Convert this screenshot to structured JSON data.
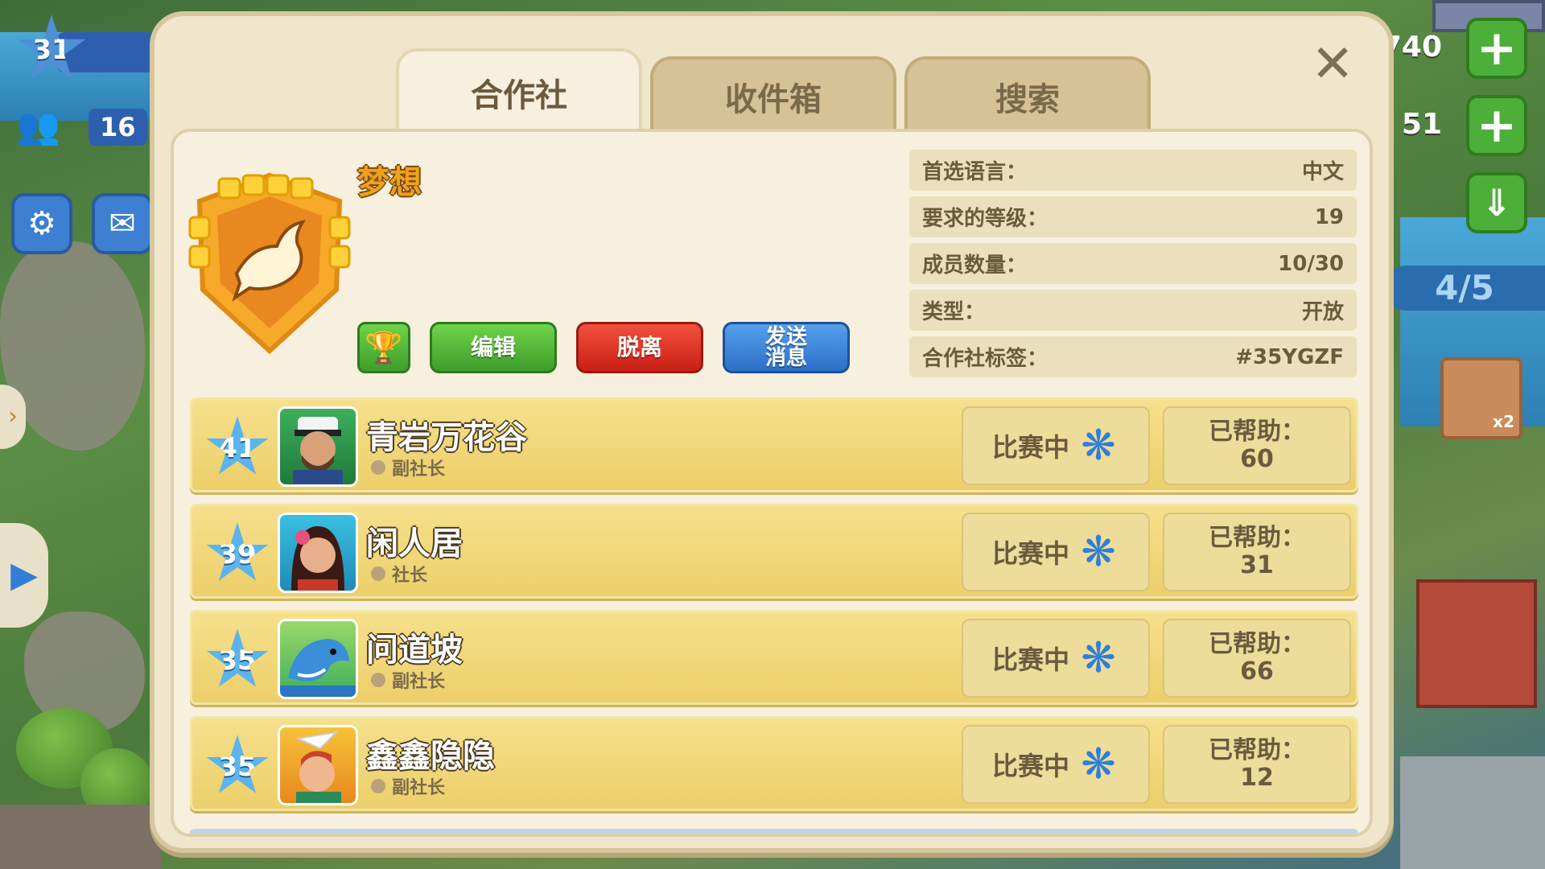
{
  "hud": {
    "level": "31",
    "population": "16",
    "right_value_1": "740",
    "right_value_2": "51",
    "counter": "4/5",
    "heli_multiplier": "x2"
  },
  "tabs": [
    {
      "label": "合作社",
      "active": true
    },
    {
      "label": "收件箱",
      "active": false
    },
    {
      "label": "搜索",
      "active": false
    }
  ],
  "club": {
    "name": "梦想",
    "buttons": {
      "edit": "编辑",
      "leave": "脱离",
      "message": "发送\n消息"
    },
    "info": [
      {
        "label": "首选语言：",
        "value": "中文"
      },
      {
        "label": "要求的等级：",
        "value": "19"
      },
      {
        "label": "成员数量：",
        "value": "10/30"
      },
      {
        "label": "类型：",
        "value": "开放"
      },
      {
        "label": "合作社标签：",
        "value": "#35YGZF"
      }
    ]
  },
  "members": [
    {
      "level": "41",
      "name": "青岩万花谷",
      "role": "副社长",
      "status": "比赛中",
      "helped_label": "已帮助：",
      "helped": "60",
      "avatar": "captain-avatar"
    },
    {
      "level": "39",
      "name": "闲人居",
      "role": "社长",
      "status": "比赛中",
      "helped_label": "已帮助：",
      "helped": "31",
      "avatar": "flower-girl-avatar"
    },
    {
      "level": "35",
      "name": "问道坡",
      "role": "副社长",
      "status": "比赛中",
      "helped_label": "已帮助：",
      "helped": "66",
      "avatar": "dolphin-avatar"
    },
    {
      "level": "35",
      "name": "鑫鑫隐隐",
      "role": "副社长",
      "status": "比赛中",
      "helped_label": "已帮助：",
      "helped": "12",
      "avatar": "paper-plane-boy-avatar"
    }
  ],
  "colors": {
    "panel_bg": "#f7f0de",
    "member_row": "#f1d87a",
    "accent_gold": "#f0a21c",
    "level_star": "#5cb4ec",
    "edit_green": "#4caf3a",
    "leave_red": "#e0342a",
    "message_blue": "#3d86dc"
  }
}
